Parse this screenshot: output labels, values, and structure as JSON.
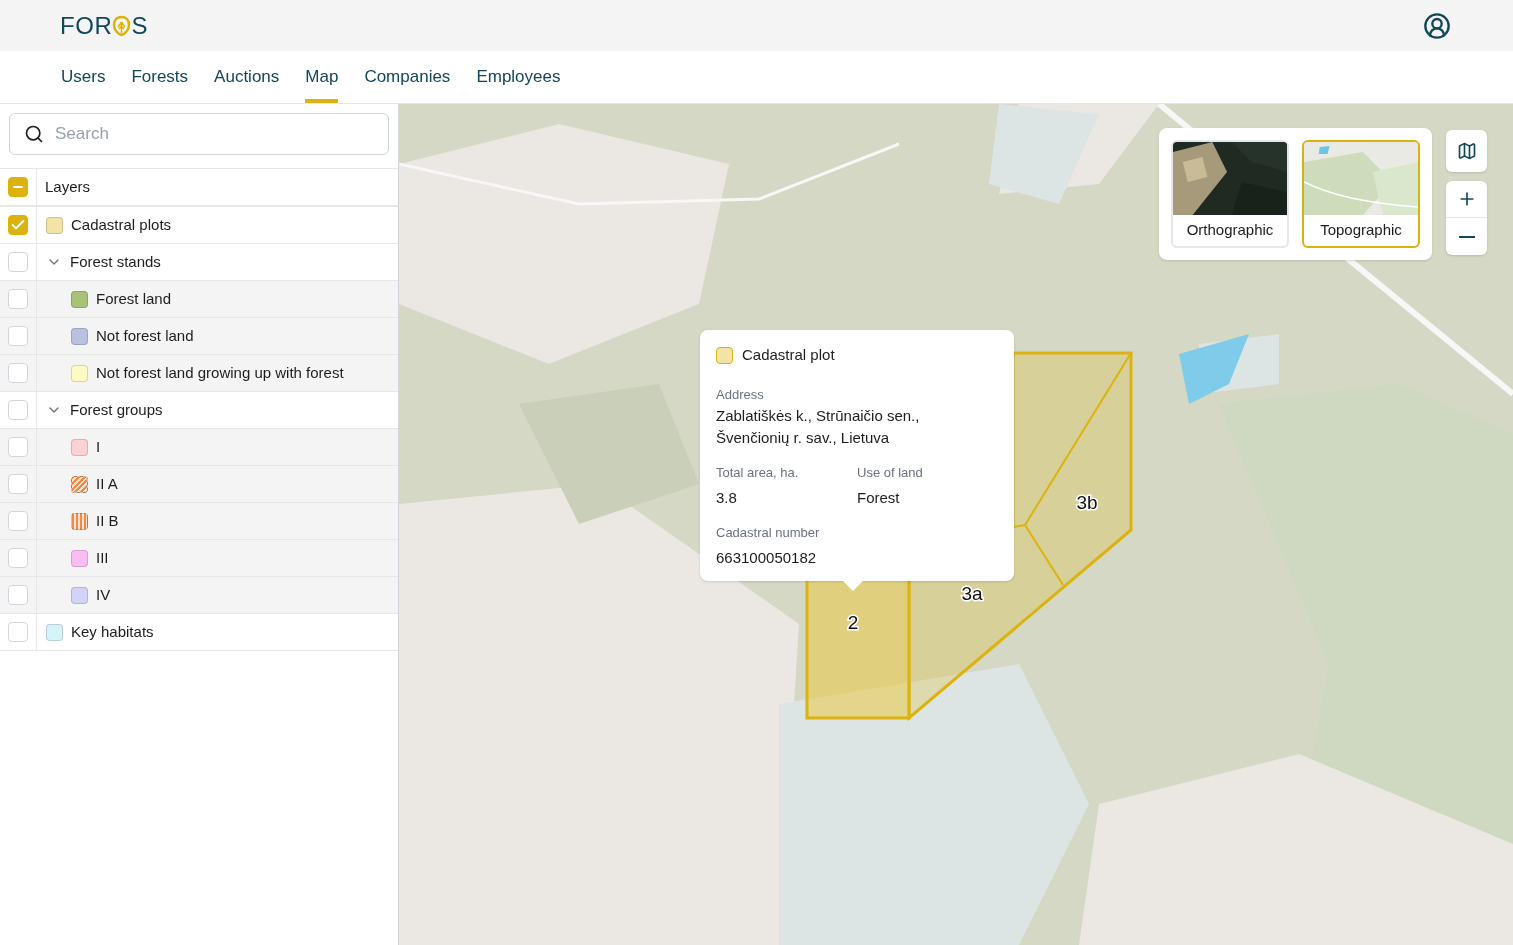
{
  "header": {
    "logo": {
      "before": "FOR",
      "after": "S"
    }
  },
  "nav": [
    {
      "label": "Users",
      "selected": false
    },
    {
      "label": "Forests",
      "selected": false
    },
    {
      "label": "Auctions",
      "selected": false
    },
    {
      "label": "Map",
      "selected": true
    },
    {
      "label": "Companies",
      "selected": false
    },
    {
      "label": "Employees",
      "selected": false
    }
  ],
  "search": {
    "placeholder": "Search"
  },
  "layers": {
    "title": "Layers",
    "checked": true,
    "indeterminate": true,
    "items": [
      {
        "label": "Cadastral plots",
        "checked": true,
        "kind": "solid",
        "color": "#f3e3a6"
      },
      {
        "label": "Forest stands",
        "checked": false,
        "expanded": true,
        "children": [
          {
            "label": "Forest land",
            "checked": false,
            "kind": "solid",
            "color": "#a9c27a"
          },
          {
            "label": "Not forest land",
            "checked": false,
            "kind": "solid",
            "color": "#b9c1e0"
          },
          {
            "label": "Not forest land growing up with forest",
            "checked": false,
            "kind": "solid",
            "color": "#fdfbc2"
          }
        ]
      },
      {
        "label": "Forest groups",
        "checked": false,
        "expanded": true,
        "children": [
          {
            "label": "I",
            "checked": false,
            "kind": "solid",
            "color": "#f9d3d3"
          },
          {
            "label": "II A",
            "checked": false,
            "kind": "diagonal",
            "color": "#f0894a"
          },
          {
            "label": "II B",
            "checked": false,
            "kind": "vertical",
            "color": "#f0894a"
          },
          {
            "label": "III",
            "checked": false,
            "kind": "solid",
            "color": "#f9bdf3"
          },
          {
            "label": "IV",
            "checked": false,
            "kind": "solid",
            "color": "#d5d2f8"
          }
        ]
      },
      {
        "label": "Key habitats",
        "checked": false,
        "kind": "solid",
        "color": "#d7f3fa"
      }
    ]
  },
  "plots": [
    {
      "label": "2"
    },
    {
      "label": "3a"
    },
    {
      "label": "3b"
    }
  ],
  "popup": {
    "title": "Cadastral plot",
    "fields": [
      {
        "label": "Address",
        "value": "Zablatiškės k., Strūnaičio sen., Švenčionių r. sav., Lietuva"
      },
      {
        "label": "Total area, ha.",
        "value": "3.8"
      },
      {
        "label": "Use of land",
        "value": "Forest"
      },
      {
        "label": "Cadastral number",
        "value": "663100050182"
      }
    ]
  },
  "map_types": [
    {
      "label": "Orthographic",
      "selected": false,
      "kind": "ortho"
    },
    {
      "label": "Topographic",
      "selected": true,
      "kind": "topo"
    }
  ]
}
